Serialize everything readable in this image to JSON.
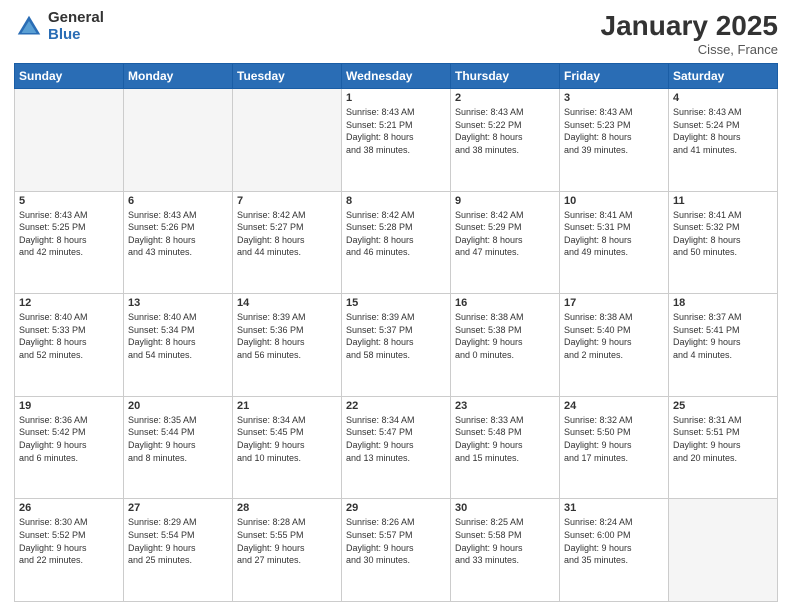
{
  "logo": {
    "general": "General",
    "blue": "Blue"
  },
  "header": {
    "month": "January 2025",
    "location": "Cisse, France"
  },
  "weekdays": [
    "Sunday",
    "Monday",
    "Tuesday",
    "Wednesday",
    "Thursday",
    "Friday",
    "Saturday"
  ],
  "weeks": [
    [
      {
        "day": "",
        "info": ""
      },
      {
        "day": "",
        "info": ""
      },
      {
        "day": "",
        "info": ""
      },
      {
        "day": "1",
        "info": "Sunrise: 8:43 AM\nSunset: 5:21 PM\nDaylight: 8 hours\nand 38 minutes."
      },
      {
        "day": "2",
        "info": "Sunrise: 8:43 AM\nSunset: 5:22 PM\nDaylight: 8 hours\nand 38 minutes."
      },
      {
        "day": "3",
        "info": "Sunrise: 8:43 AM\nSunset: 5:23 PM\nDaylight: 8 hours\nand 39 minutes."
      },
      {
        "day": "4",
        "info": "Sunrise: 8:43 AM\nSunset: 5:24 PM\nDaylight: 8 hours\nand 41 minutes."
      }
    ],
    [
      {
        "day": "5",
        "info": "Sunrise: 8:43 AM\nSunset: 5:25 PM\nDaylight: 8 hours\nand 42 minutes."
      },
      {
        "day": "6",
        "info": "Sunrise: 8:43 AM\nSunset: 5:26 PM\nDaylight: 8 hours\nand 43 minutes."
      },
      {
        "day": "7",
        "info": "Sunrise: 8:42 AM\nSunset: 5:27 PM\nDaylight: 8 hours\nand 44 minutes."
      },
      {
        "day": "8",
        "info": "Sunrise: 8:42 AM\nSunset: 5:28 PM\nDaylight: 8 hours\nand 46 minutes."
      },
      {
        "day": "9",
        "info": "Sunrise: 8:42 AM\nSunset: 5:29 PM\nDaylight: 8 hours\nand 47 minutes."
      },
      {
        "day": "10",
        "info": "Sunrise: 8:41 AM\nSunset: 5:31 PM\nDaylight: 8 hours\nand 49 minutes."
      },
      {
        "day": "11",
        "info": "Sunrise: 8:41 AM\nSunset: 5:32 PM\nDaylight: 8 hours\nand 50 minutes."
      }
    ],
    [
      {
        "day": "12",
        "info": "Sunrise: 8:40 AM\nSunset: 5:33 PM\nDaylight: 8 hours\nand 52 minutes."
      },
      {
        "day": "13",
        "info": "Sunrise: 8:40 AM\nSunset: 5:34 PM\nDaylight: 8 hours\nand 54 minutes."
      },
      {
        "day": "14",
        "info": "Sunrise: 8:39 AM\nSunset: 5:36 PM\nDaylight: 8 hours\nand 56 minutes."
      },
      {
        "day": "15",
        "info": "Sunrise: 8:39 AM\nSunset: 5:37 PM\nDaylight: 8 hours\nand 58 minutes."
      },
      {
        "day": "16",
        "info": "Sunrise: 8:38 AM\nSunset: 5:38 PM\nDaylight: 9 hours\nand 0 minutes."
      },
      {
        "day": "17",
        "info": "Sunrise: 8:38 AM\nSunset: 5:40 PM\nDaylight: 9 hours\nand 2 minutes."
      },
      {
        "day": "18",
        "info": "Sunrise: 8:37 AM\nSunset: 5:41 PM\nDaylight: 9 hours\nand 4 minutes."
      }
    ],
    [
      {
        "day": "19",
        "info": "Sunrise: 8:36 AM\nSunset: 5:42 PM\nDaylight: 9 hours\nand 6 minutes."
      },
      {
        "day": "20",
        "info": "Sunrise: 8:35 AM\nSunset: 5:44 PM\nDaylight: 9 hours\nand 8 minutes."
      },
      {
        "day": "21",
        "info": "Sunrise: 8:34 AM\nSunset: 5:45 PM\nDaylight: 9 hours\nand 10 minutes."
      },
      {
        "day": "22",
        "info": "Sunrise: 8:34 AM\nSunset: 5:47 PM\nDaylight: 9 hours\nand 13 minutes."
      },
      {
        "day": "23",
        "info": "Sunrise: 8:33 AM\nSunset: 5:48 PM\nDaylight: 9 hours\nand 15 minutes."
      },
      {
        "day": "24",
        "info": "Sunrise: 8:32 AM\nSunset: 5:50 PM\nDaylight: 9 hours\nand 17 minutes."
      },
      {
        "day": "25",
        "info": "Sunrise: 8:31 AM\nSunset: 5:51 PM\nDaylight: 9 hours\nand 20 minutes."
      }
    ],
    [
      {
        "day": "26",
        "info": "Sunrise: 8:30 AM\nSunset: 5:52 PM\nDaylight: 9 hours\nand 22 minutes."
      },
      {
        "day": "27",
        "info": "Sunrise: 8:29 AM\nSunset: 5:54 PM\nDaylight: 9 hours\nand 25 minutes."
      },
      {
        "day": "28",
        "info": "Sunrise: 8:28 AM\nSunset: 5:55 PM\nDaylight: 9 hours\nand 27 minutes."
      },
      {
        "day": "29",
        "info": "Sunrise: 8:26 AM\nSunset: 5:57 PM\nDaylight: 9 hours\nand 30 minutes."
      },
      {
        "day": "30",
        "info": "Sunrise: 8:25 AM\nSunset: 5:58 PM\nDaylight: 9 hours\nand 33 minutes."
      },
      {
        "day": "31",
        "info": "Sunrise: 8:24 AM\nSunset: 6:00 PM\nDaylight: 9 hours\nand 35 minutes."
      },
      {
        "day": "",
        "info": ""
      }
    ]
  ]
}
